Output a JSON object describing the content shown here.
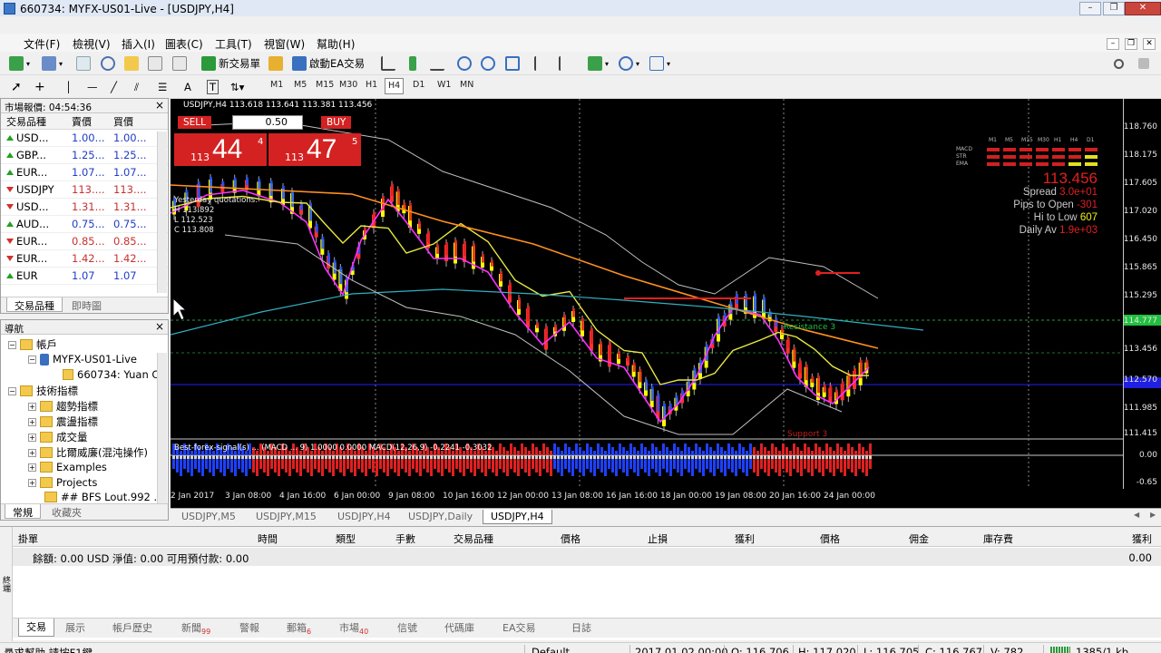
{
  "window": {
    "title": "660734: MYFX-US01-Live - [USDJPY,H4]"
  },
  "menu": [
    "文件(F)",
    "檢視(V)",
    "插入(I)",
    "圖表(C)",
    "工具(T)",
    "視窗(W)",
    "幫助(H)"
  ],
  "toolbar": {
    "new_order": "新交易單",
    "auto_trading": "啟動EA交易",
    "timeframes": [
      "M1",
      "M5",
      "M15",
      "M30",
      "H1",
      "H4",
      "D1",
      "W1",
      "MN"
    ],
    "active_timeframe": "H4"
  },
  "market_watch": {
    "title": "市場報價: 04:54:36",
    "columns": [
      "交易品種",
      "賣價",
      "買價"
    ],
    "rows": [
      {
        "symbol": "USD...",
        "bid": "1.00...",
        "ask": "1.00...",
        "dir": "up"
      },
      {
        "symbol": "GBP...",
        "bid": "1.25...",
        "ask": "1.25...",
        "dir": "up"
      },
      {
        "symbol": "EUR...",
        "bid": "1.07...",
        "ask": "1.07...",
        "dir": "up"
      },
      {
        "symbol": "USDJPY",
        "bid": "113....",
        "ask": "113....",
        "dir": "down"
      },
      {
        "symbol": "USD...",
        "bid": "1.31...",
        "ask": "1.31...",
        "dir": "down"
      },
      {
        "symbol": "AUD...",
        "bid": "0.75...",
        "ask": "0.75...",
        "dir": "up"
      },
      {
        "symbol": "EUR...",
        "bid": "0.85...",
        "ask": "0.85...",
        "dir": "down"
      },
      {
        "symbol": "EUR...",
        "bid": "1.42...",
        "ask": "1.42...",
        "dir": "down"
      },
      {
        "symbol": "EUR",
        "bid": "1.07",
        "ask": "1.07",
        "dir": "up"
      }
    ],
    "tabs": [
      "交易品種",
      "即時圖"
    ]
  },
  "navigator": {
    "title": "導航",
    "items": {
      "accounts": "帳戶",
      "server": "MYFX-US01-Live",
      "account": "660734: Yuan C",
      "indicators": "技術指標",
      "trend": "趨勢指標",
      "oscillators": "震盪指標",
      "volumes": "成交量",
      "bill_williams": "比爾威廉(混沌操作)",
      "examples": "Examples",
      "projects": "Projects",
      "bfs": "## BFS Lout.992 ."
    },
    "tabs": [
      "常規",
      "收藏夾"
    ]
  },
  "chart": {
    "header": "USDJPY,H4  113.618 113.641 113.381 113.456",
    "one_click": {
      "sell_label": "SELL",
      "buy_label": "BUY",
      "lot": "0.50",
      "sell_prefix": "113",
      "sell_big": "44",
      "sell_sup": "4",
      "buy_prefix": "113",
      "buy_big": "47",
      "buy_sup": "5"
    },
    "yesterday": [
      "Yesterday quotations:",
      "H 113.892",
      "L 112.523",
      "C 113.808"
    ],
    "info_panel": {
      "price": "113.456",
      "spread": "Spread",
      "spread_val": "3.0e+01",
      "pips_open": "Pips to Open",
      "pips_open_val": "-301",
      "hi_low": "Hi to Low",
      "hi_low_val": "607",
      "daily_av": "Daily Av",
      "daily_av_val": "1.9e+03",
      "matrix_cols": [
        "M1",
        "M5",
        "M15",
        "M30",
        "H1",
        "H4",
        "D1"
      ],
      "matrix_rows": [
        "MACD",
        "STR",
        "EMA"
      ]
    },
    "annotations": [
      "Resistance 3",
      "Support 3"
    ],
    "macd_label": "Best-forex-signal(s) ... (MACD ... 9) 1.0000 0.0000  MACD(12,26,9) -0.2241 -0.3032",
    "price_scale": [
      "118.760",
      "118.175",
      "117.605",
      "117.020",
      "116.450",
      "115.865",
      "115.295",
      "114.777",
      "113.456",
      "112.570",
      "111.985",
      "111.415"
    ],
    "macd_scale": [
      "0.00",
      "-0.65"
    ],
    "time_axis": [
      "2 Jan 2017",
      "3 Jan 08:00",
      "4 Jan 16:00",
      "6 Jan 00:00",
      "9 Jan 08:00",
      "10 Jan 16:00",
      "12 Jan 00:00",
      "13 Jan 08:00",
      "16 Jan 16:00",
      "18 Jan 00:00",
      "19 Jan 08:00",
      "20 Jan 16:00",
      "24 Jan 00:00"
    ]
  },
  "chart_tabs": [
    "USDJPY,M5",
    "USDJPY,M15",
    "USDJPY,H4",
    "USDJPY,Daily",
    "USDJPY,H4"
  ],
  "terminal": {
    "columns": [
      "掛單",
      "時間",
      "類型",
      "手數",
      "交易品種",
      "價格",
      "止損",
      "獲利",
      "價格",
      "佣金",
      "庫存費",
      "獲利"
    ],
    "balance_text": "餘額: 0.00 USD  淨值: 0.00  可用預付款: 0.00",
    "balance_value": "0.00",
    "side_label": "終端",
    "tabs": [
      {
        "label": "交易",
        "badge": ""
      },
      {
        "label": "展示",
        "badge": ""
      },
      {
        "label": "帳戶歷史",
        "badge": ""
      },
      {
        "label": "新聞",
        "badge": "99"
      },
      {
        "label": "警報",
        "badge": ""
      },
      {
        "label": "郵箱",
        "badge": "6"
      },
      {
        "label": "市場",
        "badge": "40"
      },
      {
        "label": "信號",
        "badge": ""
      },
      {
        "label": "代碼庫",
        "badge": ""
      },
      {
        "label": "EA交易",
        "badge": ""
      },
      {
        "label": "日誌",
        "badge": ""
      }
    ]
  },
  "status": {
    "help": "尋求幫助,請按F1鍵",
    "profile": "Default",
    "datetime": "2017.01.02 00:00",
    "open": "O: 116.706",
    "high": "H: 117.020",
    "low": "L: 116.705",
    "close": "C: 116.767",
    "volume": "V: 782",
    "traffic": "1385/1 kb"
  },
  "colors": {
    "bull_candle": "#ffff00",
    "bear_candle": "#ff3030",
    "hma_up": "#1e50ff",
    "hma_down": "#e02020",
    "ma_orange": "#ff9020",
    "ma_yellow": "#e8e840",
    "ma_magenta": "#ff30ff",
    "ma_cyan": "#30b0c0",
    "bid_line": "#2020ff",
    "accent_red": "#d42222"
  }
}
